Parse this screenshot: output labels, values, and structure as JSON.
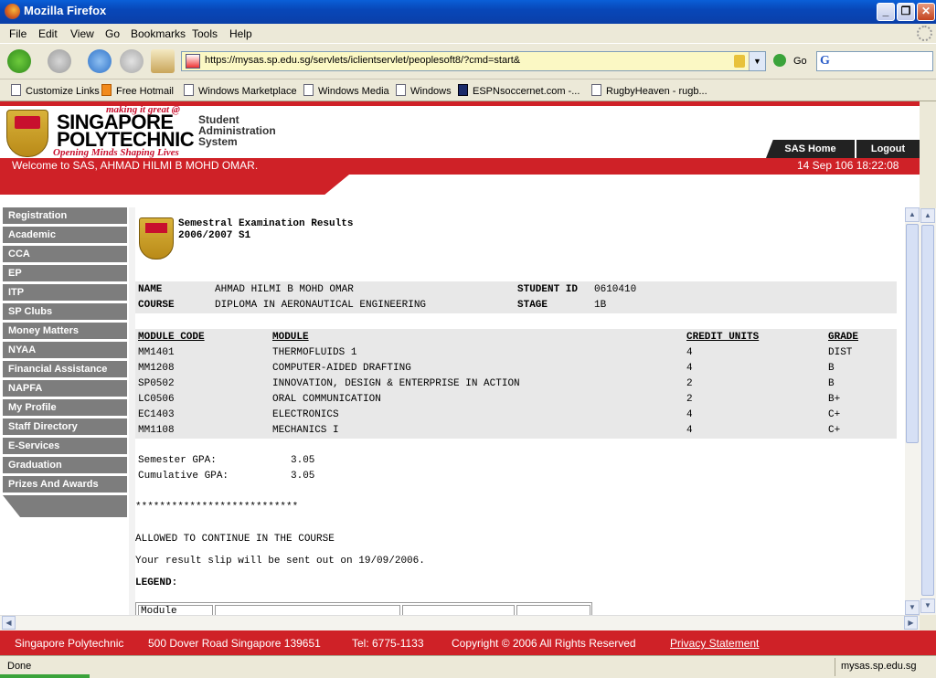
{
  "window": {
    "title": "Mozilla Firefox"
  },
  "menu": [
    "File",
    "Edit",
    "View",
    "Go",
    "Bookmarks",
    "Tools",
    "Help"
  ],
  "toolbar": {
    "url": "https://mysas.sp.edu.sg/servlets/iclientservlet/peoplesoft8/?cmd=start&",
    "go_label": "Go"
  },
  "bookmarks": [
    "Customize Links",
    "Free Hotmail",
    "Windows Marketplace",
    "Windows Media",
    "Windows",
    "ESPNsoccernet.com -...",
    "RugbyHeaven - rugb..."
  ],
  "header": {
    "tagline_top": "making it great @",
    "name_line1": "SINGAPORE",
    "name_line2": "POLYTECHNIC",
    "tagline_bottom": "Opening Minds Shaping Lives",
    "system_l1": "Student",
    "system_l2": "Administration",
    "system_l3": "System",
    "home_label": "SAS Home",
    "logout_label": "Logout",
    "welcome": "Welcome to SAS, AHMAD HILMI B MOHD OMAR.",
    "datetime": "14 Sep 106 18:22:08"
  },
  "sidebar": {
    "items": [
      "Registration",
      "Academic",
      "CCA",
      "EP",
      "ITP",
      "SP Clubs",
      "Money Matters",
      "NYAA",
      "Financial Assistance",
      "NAPFA",
      "My Profile",
      "Staff Directory",
      "E-Services",
      "Graduation",
      "Prizes And Awards"
    ]
  },
  "report": {
    "title": "Semestral Examination Results",
    "term": "2006/2007 S1",
    "name_label": "NAME",
    "name_value": "AHMAD HILMI B MOHD OMAR",
    "course_label": "COURSE",
    "course_value": "DIPLOMA IN AERONAUTICAL ENGINEERING",
    "sid_label": "STUDENT ID",
    "sid_value": "0610410",
    "stage_label": "STAGE",
    "stage_value": "1B",
    "columns": [
      "MODULE CODE",
      "MODULE",
      "CREDIT UNITS",
      "GRADE"
    ],
    "rows": [
      [
        "MM1401",
        "THERMOFLUIDS 1",
        "4",
        "DIST"
      ],
      [
        "MM1208",
        "COMPUTER-AIDED DRAFTING",
        "4",
        "B"
      ],
      [
        "SP0502",
        "INNOVATION, DESIGN & ENTERPRISE IN ACTION",
        "2",
        "B"
      ],
      [
        "LC0506",
        "ORAL COMMUNICATION",
        "2",
        "B+"
      ],
      [
        "EC1403",
        "ELECTRONICS",
        "4",
        "C+"
      ],
      [
        "MM1108",
        "MECHANICS I",
        "4",
        "C+"
      ]
    ],
    "sem_gpa_label": "Semester GPA:",
    "sem_gpa": "3.05",
    "cum_gpa_label": "Cumulative GPA:",
    "cum_gpa": "3.05",
    "stars": "***************************",
    "status": "ALLOWED TO CONTINUE IN THE COURSE",
    "slip": "Your result slip will be sent out on 19/09/2006.",
    "legend_label": "LEGEND:",
    "legend_first_cell": "Module"
  },
  "footer": {
    "org": "Singapore Polytechnic",
    "address": "500 Dover Road Singapore 139651",
    "tel": "Tel: 6775-1133",
    "copyright": "Copyright © 2006 All Rights Reserved",
    "privacy": "Privacy Statement"
  },
  "status": {
    "text": "Done",
    "host": "mysas.sp.edu.sg"
  }
}
